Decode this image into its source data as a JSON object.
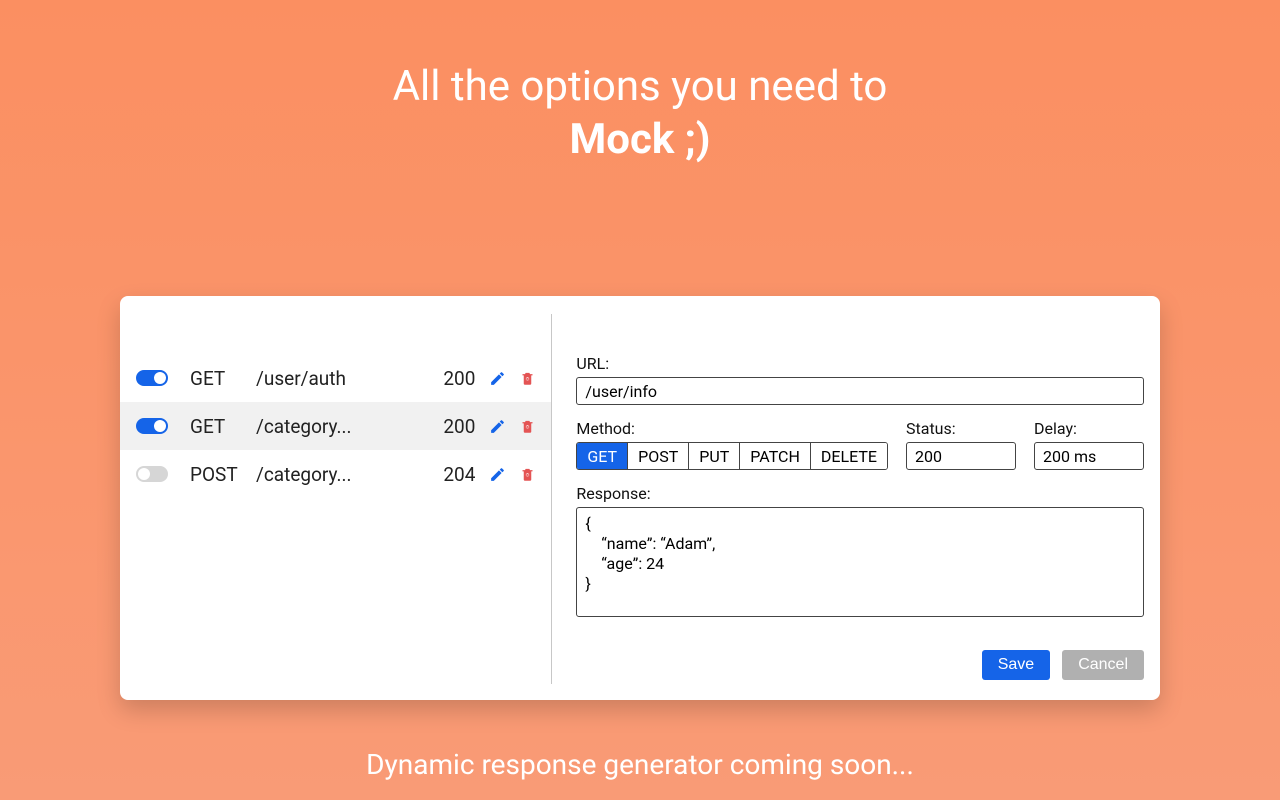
{
  "hero": {
    "line1": "All the options you need to",
    "line2": "Mock ;)"
  },
  "mocks": [
    {
      "enabled": true,
      "method": "GET",
      "path": "/user/auth",
      "status": "200",
      "selected": false
    },
    {
      "enabled": true,
      "method": "GET",
      "path": "/category...",
      "status": "200",
      "selected": true
    },
    {
      "enabled": false,
      "method": "POST",
      "path": "/category...",
      "status": "204",
      "selected": false
    }
  ],
  "form": {
    "url_label": "URL:",
    "url_value": "/user/info",
    "method_label": "Method:",
    "methods": [
      "GET",
      "POST",
      "PUT",
      "PATCH",
      "DELETE"
    ],
    "method_active": "GET",
    "status_label": "Status:",
    "status_value": "200",
    "delay_label": "Delay:",
    "delay_value": "200 ms",
    "response_label": "Response:",
    "response_value": "{\n    “name”: “Adam”,\n    “age”: 24\n}",
    "save_label": "Save",
    "cancel_label": "Cancel"
  },
  "footer": "Dynamic response generator coming soon..."
}
